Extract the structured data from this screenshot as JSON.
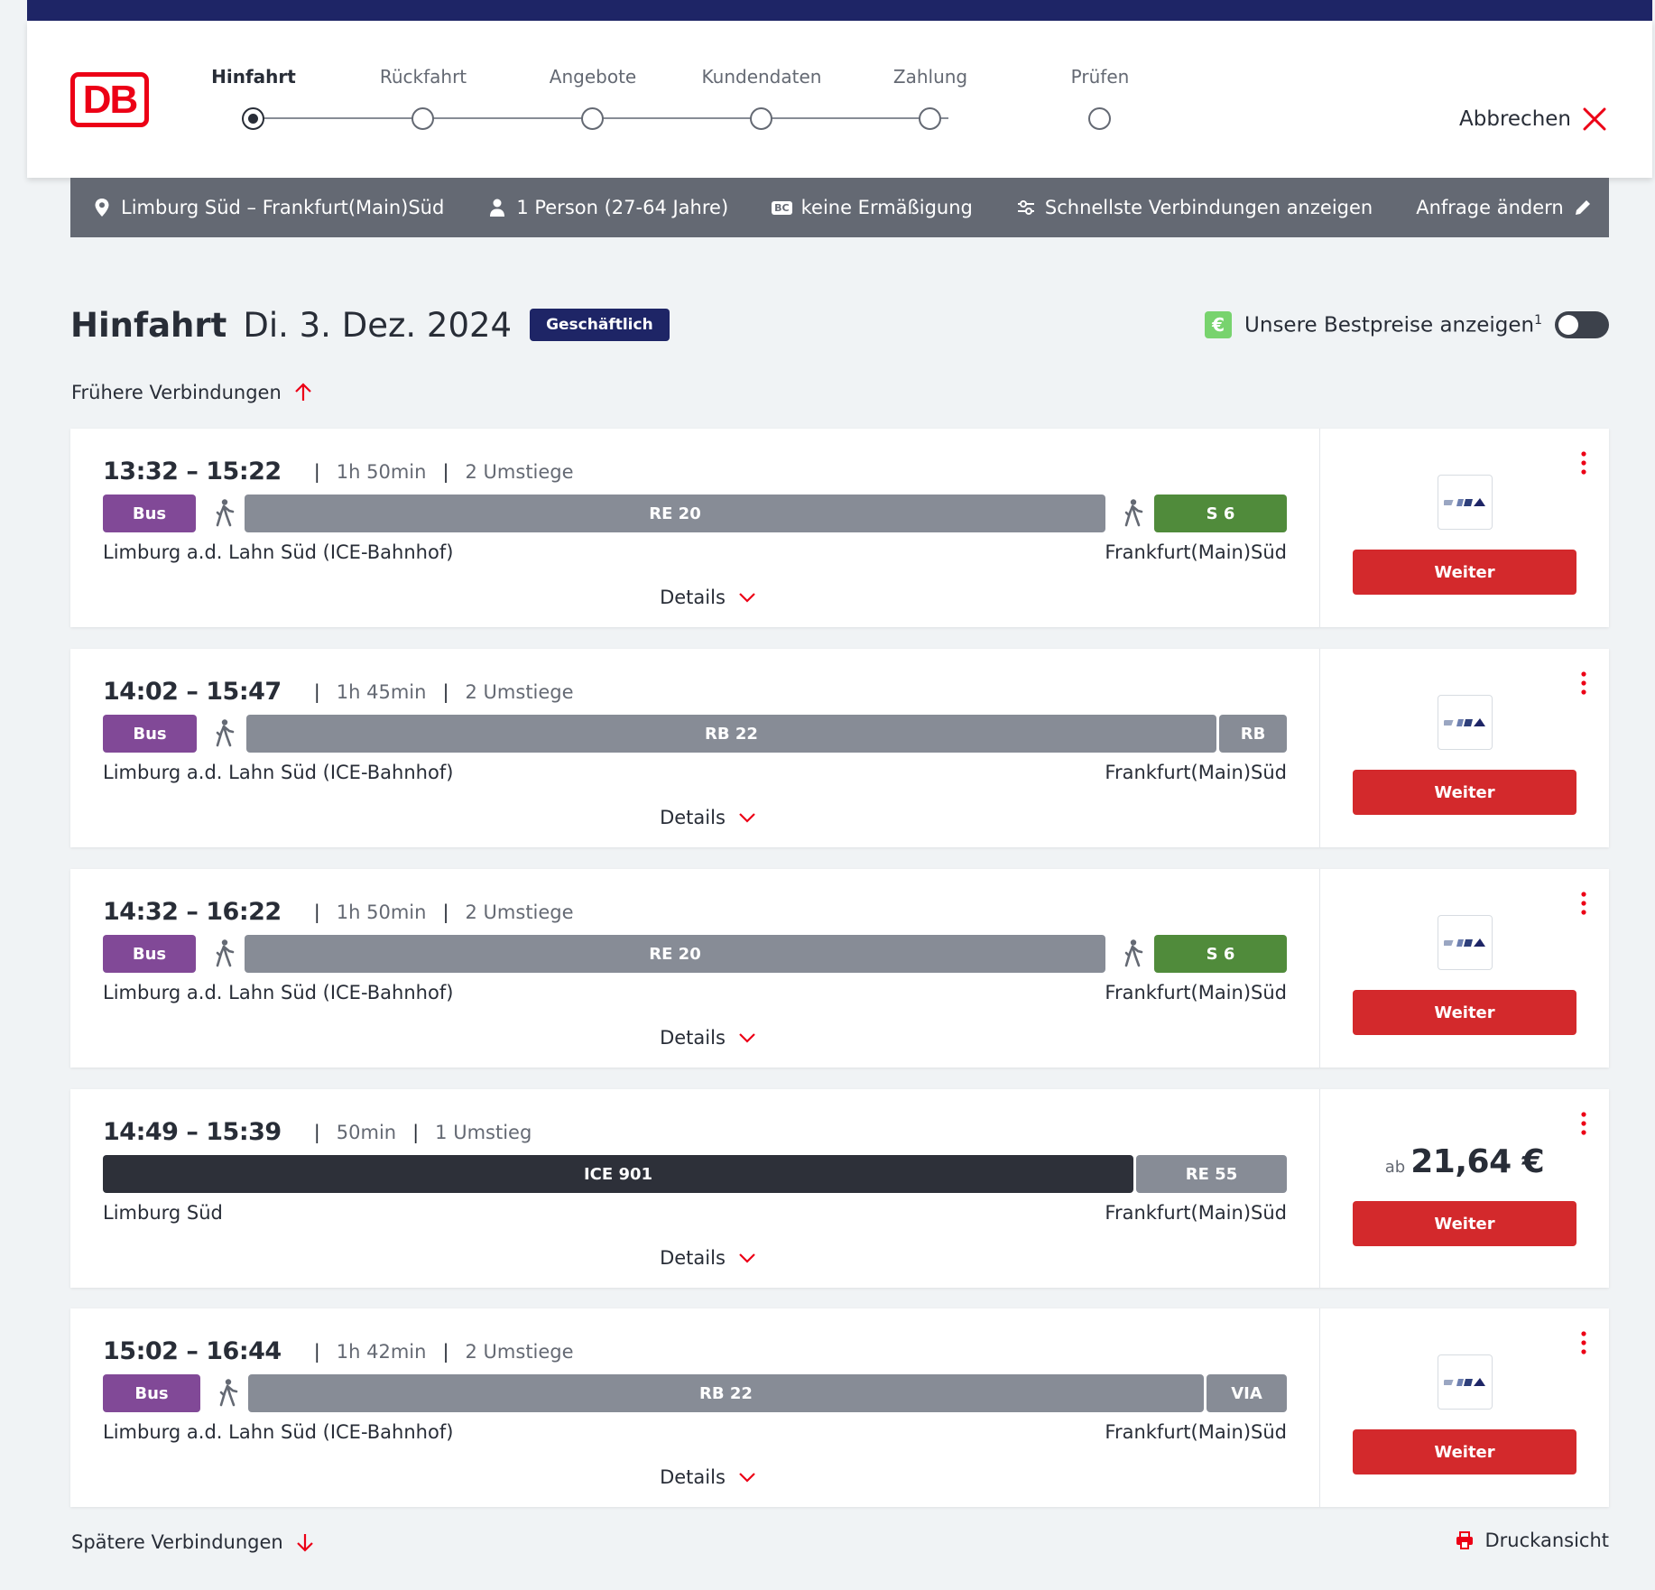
{
  "brand": {
    "logo_text": "DB",
    "color": "#ec0016"
  },
  "steps": [
    {
      "label": "Hinfahrt",
      "active": true
    },
    {
      "label": "Rückfahrt",
      "active": false
    },
    {
      "label": "Angebote",
      "active": false
    },
    {
      "label": "Kundendaten",
      "active": false
    },
    {
      "label": "Zahlung",
      "active": false
    },
    {
      "label": "Prüfen",
      "active": false
    }
  ],
  "header": {
    "cancel_label": "Abbrechen"
  },
  "query": {
    "route": "Limburg Süd – Frankfurt(Main)Süd",
    "passengers": "1 Person (27-64 Jahre)",
    "bc_label": "BC",
    "discount": "keine Ermäßigung",
    "filter": "Schnellste Verbindungen anzeigen",
    "edit_label": "Anfrage ändern"
  },
  "title": {
    "direction": "Hinfahrt",
    "date": "Di. 3. Dez. 2024",
    "badge": "Geschäftlich",
    "bestprice_label": "Unsere Bestpreise anzeigen",
    "bestprice_sup": "1",
    "euro_symbol": "€",
    "bestprice_toggle_on": false
  },
  "earlier_label": "Frühere Verbindungen",
  "later_label": "Spätere Verbindungen",
  "print_label": "Druckansicht",
  "details_label": "Details",
  "weiter_label": "Weiter",
  "price_prefix": "ab",
  "connections": [
    {
      "time": "13:32 – 15:22",
      "duration": "1h 50min",
      "changes": "2 Umstiege",
      "from": "Limburg a.d. Lahn Süd (ICE-Bahnhof)",
      "to": "Frankfurt(Main)Süd",
      "segments": [
        {
          "label": "Bus",
          "type": "bus"
        },
        {
          "label": "RE 20",
          "type": "gray"
        },
        {
          "label": "S 6",
          "type": "green"
        }
      ],
      "price": null
    },
    {
      "time": "14:02 – 15:47",
      "duration": "1h 45min",
      "changes": "2 Umstiege",
      "from": "Limburg a.d. Lahn Süd (ICE-Bahnhof)",
      "to": "Frankfurt(Main)Süd",
      "segments": [
        {
          "label": "Bus",
          "type": "bus"
        },
        {
          "label": "RB 22",
          "type": "gray"
        },
        {
          "label": "RB",
          "type": "gray"
        }
      ],
      "price": null
    },
    {
      "time": "14:32 – 16:22",
      "duration": "1h 50min",
      "changes": "2 Umstiege",
      "from": "Limburg a.d. Lahn Süd (ICE-Bahnhof)",
      "to": "Frankfurt(Main)Süd",
      "segments": [
        {
          "label": "Bus",
          "type": "bus"
        },
        {
          "label": "RE 20",
          "type": "gray"
        },
        {
          "label": "S 6",
          "type": "green"
        }
      ],
      "price": null
    },
    {
      "time": "14:49 – 15:39",
      "duration": "50min",
      "changes": "1 Umstieg",
      "from": "Limburg Süd",
      "to": "Frankfurt(Main)Süd",
      "segments": [
        {
          "label": "ICE 901",
          "type": "dark"
        },
        {
          "label": "RE 55",
          "type": "gray"
        }
      ],
      "price": "21,64 €"
    },
    {
      "time": "15:02 – 16:44",
      "duration": "1h 42min",
      "changes": "2 Umstiege",
      "from": "Limburg a.d. Lahn Süd (ICE-Bahnhof)",
      "to": "Frankfurt(Main)Süd",
      "segments": [
        {
          "label": "Bus",
          "type": "bus"
        },
        {
          "label": "RB 22",
          "type": "gray"
        },
        {
          "label": "VIA",
          "type": "gray"
        }
      ],
      "price": null
    }
  ],
  "colors": {
    "navy": "#1e2566",
    "db_red": "#ec0016",
    "button_red": "#d3292c",
    "bus_purple": "#814997",
    "sbahn_green": "#508b3b",
    "regional_gray": "#878c96",
    "ice_dark": "#2d3039"
  }
}
